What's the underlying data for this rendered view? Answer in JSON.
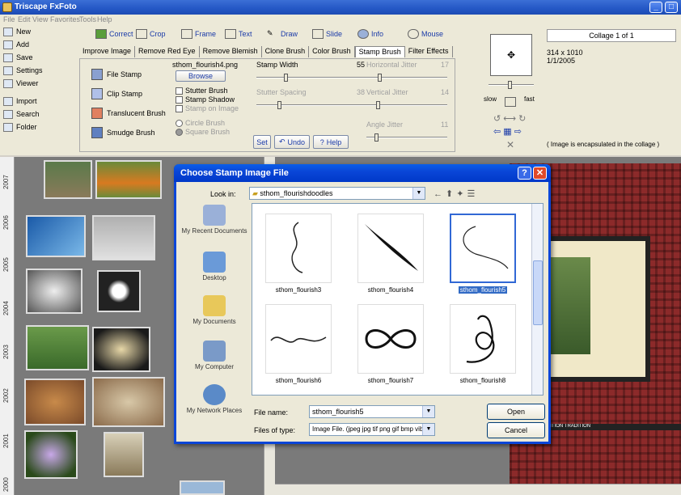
{
  "app": {
    "title": "Triscape FxFoto"
  },
  "menu": [
    "File",
    "Edit",
    "View",
    "Favorites",
    "Tools",
    "Help"
  ],
  "left_toolbar": [
    "New",
    "Add",
    "Save",
    "Settings",
    "Viewer",
    "Import",
    "Search",
    "Folder"
  ],
  "top_toolbar": [
    "Correct",
    "Crop",
    "Frame",
    "Text",
    "Draw",
    "Slide",
    "Info",
    "Mouse"
  ],
  "tabs": [
    "Improve Image",
    "Remove Red Eye",
    "Remove Blemish",
    "Clone Brush",
    "Color Brush",
    "Stamp Brush",
    "Filter Effects"
  ],
  "tools": [
    "File Stamp",
    "Clip Stamp",
    "Translucent Brush",
    "Smudge Brush"
  ],
  "stamp": {
    "filename": "sthom_flourish4.png",
    "browse": "Browse",
    "options": [
      "Stutter Brush",
      "Stamp Shadow",
      "Stamp on Image",
      "Circle Brush",
      "Square Brush"
    ],
    "width_label": "Stamp Width",
    "width_value": "55",
    "spacing_label": "Stutter Spacing",
    "spacing_value": "38",
    "hjitter_label": "Horizontal Jitter",
    "hjitter_value": "17",
    "vjitter_label": "Vertical Jitter",
    "vjitter_value": "14",
    "ajitter_label": "Angle Jitter",
    "ajitter_value": "11",
    "set": "Set",
    "undo": "Undo",
    "help": "Help"
  },
  "nav": {
    "slow": "slow",
    "fast": "fast"
  },
  "info": {
    "collage": "Collage 1 of 1",
    "size": "314 x 1010",
    "date": "1/1/2005",
    "note": "( Image is encapsulated in the collage )"
  },
  "ruler_years": [
    "2007",
    "2006",
    "2005",
    "2004",
    "2003",
    "2002",
    "2001",
    "2000"
  ],
  "dialog": {
    "title": "Choose Stamp Image File",
    "look_in_label": "Look in:",
    "look_in_value": "sthom_flourishdoodles",
    "places": [
      "My Recent Documents",
      "Desktop",
      "My Documents",
      "My Computer",
      "My Network Places"
    ],
    "files": [
      "sthom_flourish3",
      "sthom_flourish4",
      "sthom_flourish5",
      "sthom_flourish6",
      "sthom_flourish7",
      "sthom_flourish8"
    ],
    "selected": "sthom_flourish5",
    "file_name_label": "File name:",
    "file_name_value": "sthom_flourish5",
    "file_type_label": "Files of type:",
    "file_type_value": "Image File. (jpeg jpg tif png gif bmp vib wmf)",
    "open": "Open",
    "cancel": "Cancel"
  },
  "collage_text": "TRADITION TRADITION TRADITION"
}
